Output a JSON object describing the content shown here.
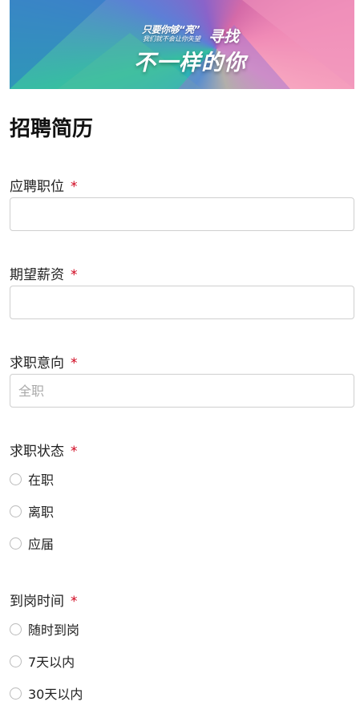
{
  "banner": {
    "slogan_line1": "只要你够“亮”",
    "slogan_line2": "我们就不会让你失望",
    "slogan_mid": "寻找",
    "slogan_big": "不一样的你"
  },
  "form": {
    "title": "招聘简历",
    "required_mark": "*",
    "position": {
      "label": "应聘职位",
      "value": "",
      "placeholder": ""
    },
    "salary": {
      "label": "期望薪资",
      "value": "",
      "placeholder": ""
    },
    "intention": {
      "label": "求职意向",
      "value": "",
      "placeholder": "全职"
    },
    "status": {
      "label": "求职状态",
      "options": [
        "在职",
        "离职",
        "应届"
      ]
    },
    "arrival": {
      "label": "到岗时间",
      "options": [
        "随时到岗",
        "7天以内",
        "30天以内"
      ]
    }
  },
  "colors": {
    "required": "#d0021b",
    "border": "#cfcfcf"
  }
}
